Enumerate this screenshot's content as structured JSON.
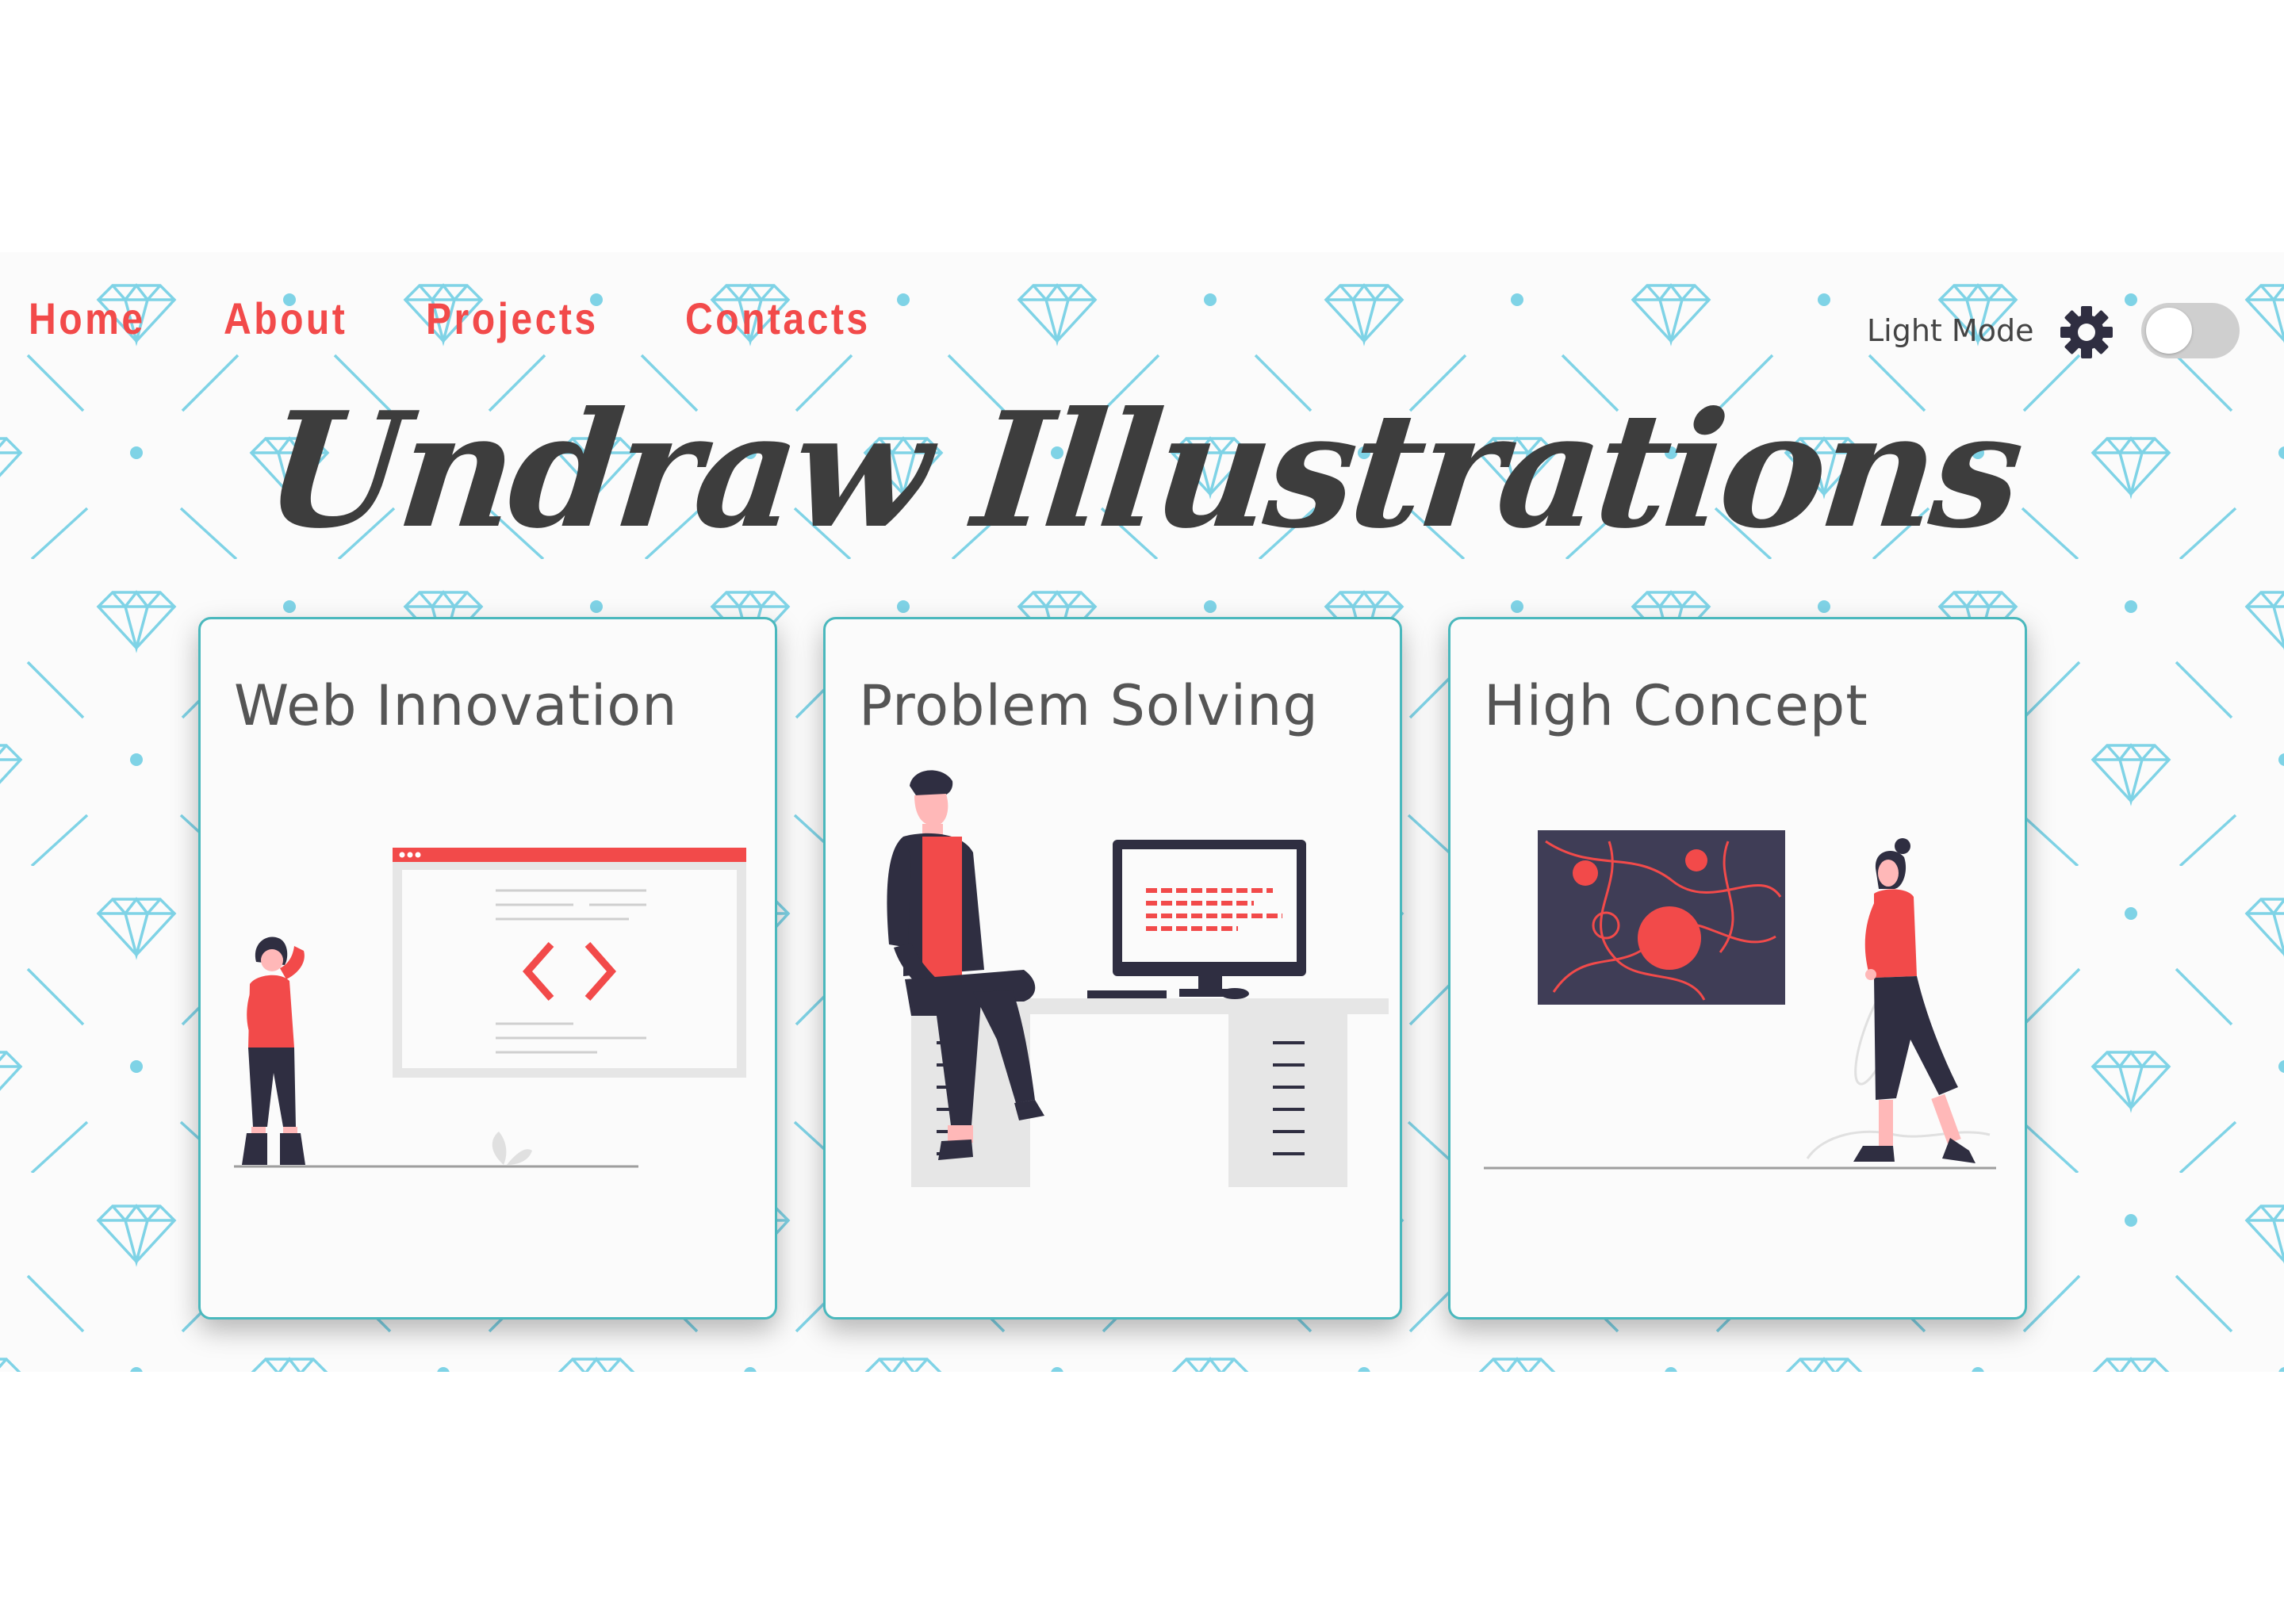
{
  "nav": {
    "links": [
      {
        "label": "Home"
      },
      {
        "label": "About"
      },
      {
        "label": "Projects"
      },
      {
        "label": "Contacts"
      }
    ]
  },
  "theme": {
    "mode_label": "Light Mode",
    "icon": "gear-icon",
    "toggle_state": "off"
  },
  "hero": {
    "title": "Undraw Illustrations"
  },
  "cards": [
    {
      "title": "Web Innovation",
      "illustration": "woman-browser-code-icon"
    },
    {
      "title": "Problem Solving",
      "illustration": "man-desk-computer-icon"
    },
    {
      "title": "High Concept",
      "illustration": "woman-abstract-art-icon"
    }
  ],
  "colors": {
    "accent": "#f24a4a",
    "card_border": "#4ab8bd",
    "pattern": "#7fd3e6",
    "figure_dark": "#2f2e41",
    "title_text": "#3d3d3d"
  }
}
